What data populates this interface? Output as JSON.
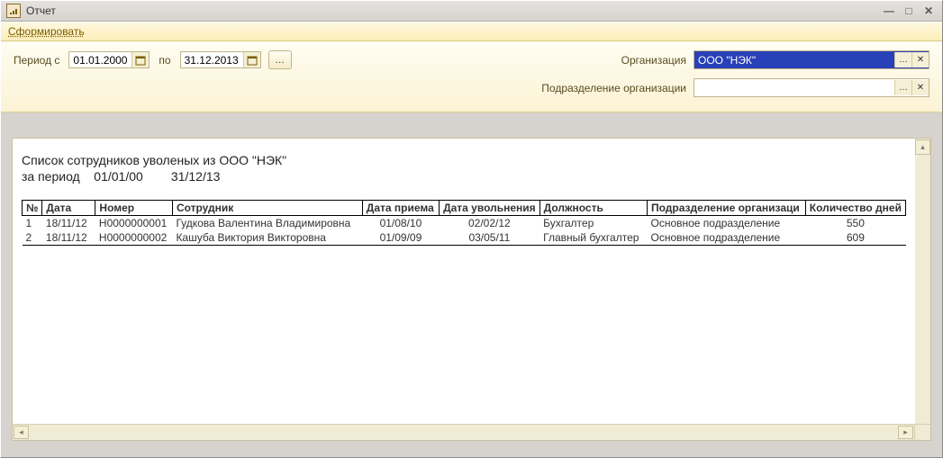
{
  "window": {
    "title": "Отчет"
  },
  "linkbar": {
    "generate": "Сформировать"
  },
  "filters": {
    "period_from_label": "Период с",
    "period_to_label": "по",
    "from": "01.01.2000",
    "to": "31.12.2013",
    "org_label": "Организация",
    "org_value": "ООО \"НЭК\"",
    "dept_label": "Подразделение организации",
    "dept_value": ""
  },
  "report": {
    "title": "Список сотрудников уволеных из ООО \"НЭК\"",
    "sub_label": "за период",
    "sub_from": "01/01/00",
    "sub_to": "31/12/13",
    "columns": {
      "no": "№",
      "date": "Дата",
      "num": "Номер",
      "emp": "Сотрудник",
      "hire": "Дата приема",
      "fire": "Дата увольнения",
      "pos": "Должность",
      "dept": "Подразделение организаци",
      "days": "Количество дней"
    },
    "rows": [
      {
        "no": "1",
        "date": "18/11/12",
        "num": "Н0000000001",
        "emp": "Гудкова Валентина Владимировна",
        "hire": "01/08/10",
        "fire": "02/02/12",
        "pos": "Бухгалтер",
        "dept": "Основное подразделение",
        "days": "550"
      },
      {
        "no": "2",
        "date": "18/11/12",
        "num": "Н0000000002",
        "emp": "Кашуба Виктория Викторовна",
        "hire": "01/09/09",
        "fire": "03/05/11",
        "pos": "Главный бухгалтер",
        "dept": "Основное подразделение",
        "days": "609"
      }
    ]
  }
}
